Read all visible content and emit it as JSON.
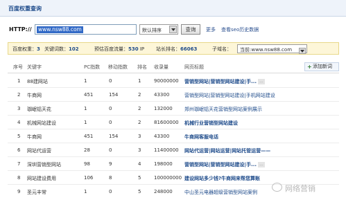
{
  "page": {
    "title": "百度权重查询"
  },
  "query": {
    "url_label": "HTTP://",
    "url_value": "www.nsw88.com",
    "sort_value": "默认排序",
    "query_button": "查询",
    "more_link": "更多",
    "history_link": "查看seo历史数据"
  },
  "stats": {
    "weight_label": "百度权重：",
    "weight": "3",
    "keywords_label": "关键词数：",
    "keywords": "102",
    "traffic_label": "预估百度流量：",
    "traffic": "530",
    "traffic_unit": "IP",
    "rank_label": "站长排名：",
    "rank": "66063",
    "subdomain_label": "子域名：",
    "subdomain_value": "当前:www.nsw88.com"
  },
  "table": {
    "headers": {
      "idx": "序号",
      "keyword": "关键字",
      "pc": "PC指数",
      "mobile": "移动指数",
      "rank": "排名",
      "count": "收录量",
      "title": "网页标题"
    },
    "add_button": "添加新词",
    "rows": [
      {
        "idx": "1",
        "keyword": "88建网站",
        "pc": "1",
        "mobile": "0",
        "rank": "1",
        "count": "90000000",
        "title": "营销型网站|营销型网站建设|手...",
        "tag": "..."
      },
      {
        "idx": "2",
        "keyword": "牛商网",
        "pc": "451",
        "mobile": "154",
        "rank": "2",
        "count": "43300",
        "title": "营销型网站|营销型网站建设|手机网站建设",
        "tag": ""
      },
      {
        "idx": "3",
        "keyword": "珈岷铝天花",
        "pc": "1",
        "mobile": "0",
        "rank": "2",
        "count": "132000",
        "title": "郑州珈岷铝天花营销型网站案例展示",
        "tag": ""
      },
      {
        "idx": "4",
        "keyword": "机械网站建设",
        "pc": "1",
        "mobile": "0",
        "rank": "2",
        "count": "81600000",
        "title": "机械行业营销型网站建设",
        "tag": ""
      },
      {
        "idx": "5",
        "keyword": "牛商网",
        "pc": "451",
        "mobile": "154",
        "rank": "3",
        "count": "43300",
        "title": "牛商网客服电话",
        "tag": ""
      },
      {
        "idx": "6",
        "keyword": "网站代运营",
        "pc": "28",
        "mobile": "0",
        "rank": "3",
        "count": "11400000",
        "title": "网站代运营|网站运营|网站托管运营——",
        "tag": ""
      },
      {
        "idx": "7",
        "keyword": "深圳营销型网站",
        "pc": "98",
        "mobile": "9",
        "rank": "4",
        "count": "198000",
        "title": "营销型网站|营销型网站建设|手...",
        "tag": "..."
      },
      {
        "idx": "8",
        "keyword": "网站建设费用",
        "pc": "106",
        "mobile": "8",
        "rank": "5",
        "count": "100000000",
        "title": "建设网站多少钱?牛商网来帮您算账",
        "tag": ""
      },
      {
        "idx": "9",
        "keyword": "圣元丰常",
        "pc": "1",
        "mobile": "0",
        "rank": "5",
        "count": "248000",
        "title": "中山圣元电器超级营销型网站案例",
        "tag": ""
      }
    ]
  },
  "watermark": {
    "text": "网络营销"
  }
}
